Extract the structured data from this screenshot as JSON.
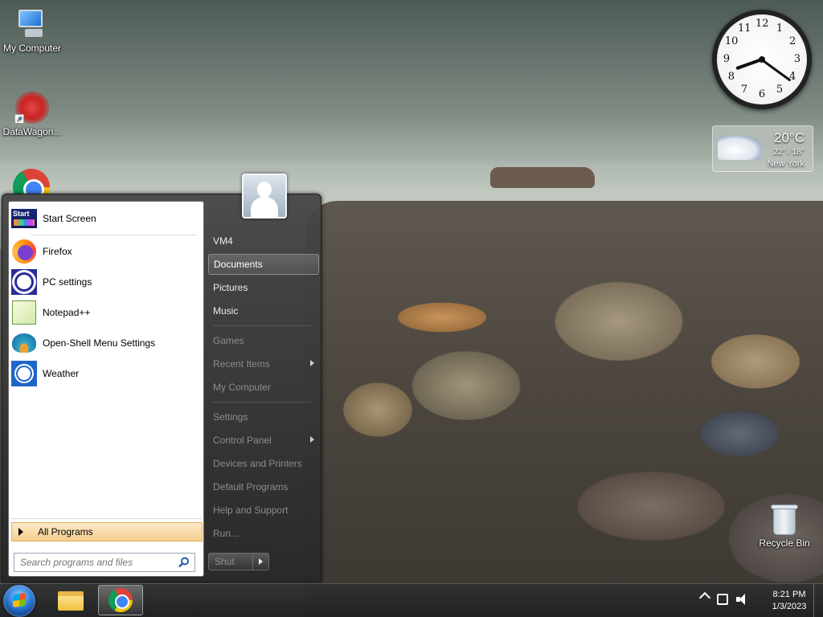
{
  "desktop": {
    "icons": [
      {
        "label": "My Computer"
      },
      {
        "label": "DataWagon..."
      },
      {
        "label": "Recycle Bin"
      }
    ]
  },
  "clock_gadget": {
    "numbers": [
      "12",
      "1",
      "2",
      "3",
      "4",
      "5",
      "6",
      "7",
      "8",
      "9",
      "10",
      "11"
    ],
    "hour": 8,
    "minute": 21
  },
  "weather_gadget": {
    "temperature": "20°C",
    "range": "22° / 18°",
    "city": "New York"
  },
  "start_menu": {
    "programs": [
      {
        "label": "Start Screen",
        "icon": "start-screen-icon"
      },
      {
        "label": "Firefox",
        "icon": "firefox-icon"
      },
      {
        "label": "PC settings",
        "icon": "gear-icon"
      },
      {
        "label": "Notepad++",
        "icon": "notepad-plus-plus-icon"
      },
      {
        "label": "Open-Shell Menu Settings",
        "icon": "shell-icon"
      },
      {
        "label": "Weather",
        "icon": "weather-sun-icon"
      }
    ],
    "all_programs": "All Programs",
    "search_placeholder": "Search programs and files",
    "right_items": [
      {
        "label": "VM4",
        "dim": false,
        "submenu": false
      },
      {
        "label": "Documents",
        "dim": false,
        "submenu": false,
        "highlighted": true
      },
      {
        "label": "Pictures",
        "dim": false,
        "submenu": false
      },
      {
        "label": "Music",
        "dim": false,
        "submenu": false
      },
      {
        "label": "Games",
        "dim": true,
        "submenu": false
      },
      {
        "label": "Recent Items",
        "dim": true,
        "submenu": true
      },
      {
        "label": "My Computer",
        "dim": true,
        "submenu": false
      },
      {
        "label": "Settings",
        "dim": true,
        "submenu": false
      },
      {
        "label": "Control Panel",
        "dim": true,
        "submenu": true
      },
      {
        "label": "Devices and Printers",
        "dim": true,
        "submenu": false
      },
      {
        "label": "Default Programs",
        "dim": true,
        "submenu": false
      },
      {
        "label": "Help and Support",
        "dim": true,
        "submenu": false
      },
      {
        "label": "Run...",
        "dim": true,
        "submenu": false
      }
    ],
    "shutdown_label": "Shut"
  },
  "taskbar": {
    "time": "8:21 PM",
    "date": "1/3/2023"
  }
}
